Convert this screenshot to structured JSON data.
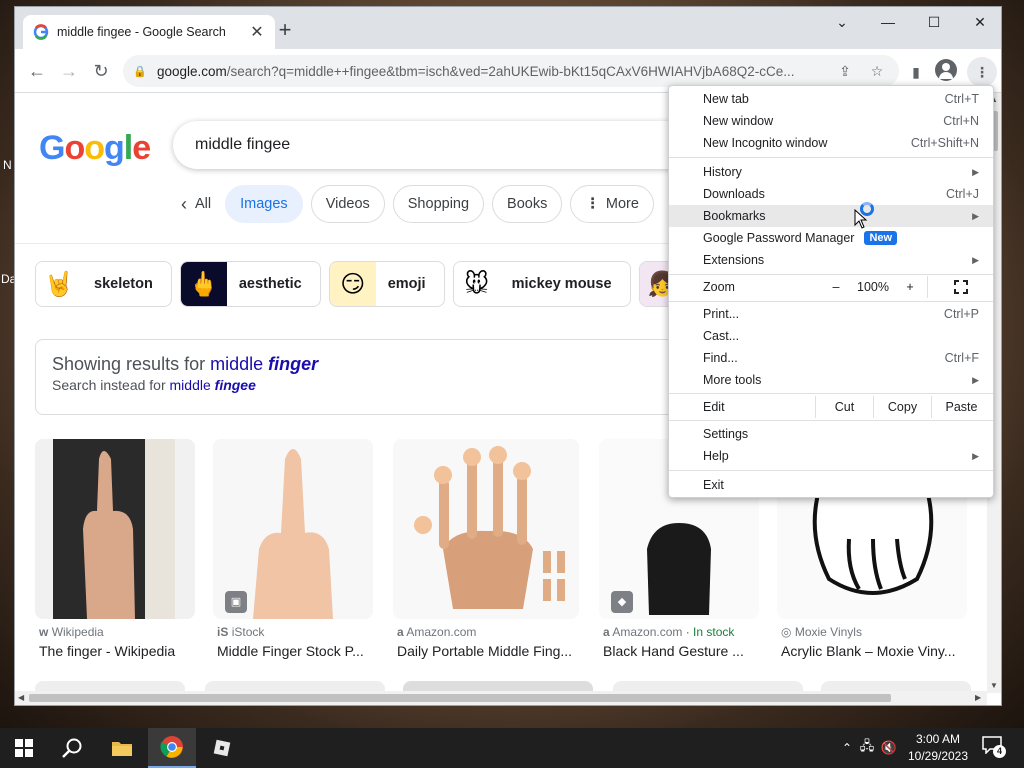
{
  "desktop": {
    "left_label_1": "N",
    "left_label_2": "Da"
  },
  "browser": {
    "tab": {
      "title": "middle fingee - Google Search",
      "close": "✕"
    },
    "new_tab": "+",
    "window_controls": {
      "tabsearch": "⌄",
      "minimize": "—",
      "maximize": "☐",
      "close": "✕"
    },
    "nav": {
      "back": "←",
      "forward": "→",
      "reload": "↻"
    },
    "url": {
      "domain": "google.com",
      "path": "/search?q=middle++fingee&tbm=isch&ved=2ahUKEwib-bKt15qCAxV6HWIAHVjbA68Q2-cCe..."
    }
  },
  "google": {
    "logo": [
      "G",
      "o",
      "o",
      "g",
      "l",
      "e"
    ],
    "query": "middle  fingee",
    "chips": [
      {
        "label": "All",
        "prefix": "‹"
      },
      {
        "label": "Images"
      },
      {
        "label": "Videos"
      },
      {
        "label": "Shopping"
      },
      {
        "label": "Books"
      },
      {
        "label": "More",
        "prefix": "⋮"
      }
    ],
    "refinements": [
      {
        "label": "skeleton",
        "icon": "🤘"
      },
      {
        "label": "aesthetic",
        "icon": "🖕"
      },
      {
        "label": "emoji",
        "icon": "😏"
      },
      {
        "label": "mickey mouse",
        "icon": "🐭"
      },
      {
        "label": "",
        "icon": "👧"
      }
    ],
    "did_you_mean": {
      "showing_prefix": "Showing results for ",
      "showing_word1": "middle",
      "showing_word2": "finger",
      "instead_prefix": "Search instead for ",
      "instead_word1": "middle",
      "instead_word2": "fingee"
    },
    "results": [
      {
        "source": "Wikipedia",
        "source_icon": "w",
        "title": "The finger - Wikipedia"
      },
      {
        "source": "iStock",
        "source_icon": "iS",
        "title": "Middle Finger Stock P..."
      },
      {
        "source": "Amazon.com",
        "source_icon": "a",
        "title": "Daily Portable Middle Fing..."
      },
      {
        "source": "Amazon.com",
        "source_icon": "a",
        "instock": " · In stock",
        "title": "Black Hand Gesture ..."
      },
      {
        "source": "Moxie Vinyls",
        "source_icon": "◎",
        "title": "Acrylic Blank – Moxie Viny..."
      }
    ]
  },
  "menu": {
    "items": {
      "new_tab": {
        "label": "New tab",
        "shortcut": "Ctrl+T"
      },
      "new_window": {
        "label": "New window",
        "shortcut": "Ctrl+N"
      },
      "new_incognito": {
        "label": "New Incognito window",
        "shortcut": "Ctrl+Shift+N"
      },
      "history": {
        "label": "History"
      },
      "downloads": {
        "label": "Downloads",
        "shortcut": "Ctrl+J"
      },
      "bookmarks": {
        "label": "Bookmarks"
      },
      "password_manager": {
        "label": "Google Password Manager",
        "badge": "New"
      },
      "extensions": {
        "label": "Extensions"
      },
      "zoom": {
        "label": "Zoom",
        "minus": "–",
        "value": "100%",
        "plus": "+"
      },
      "print": {
        "label": "Print...",
        "shortcut": "Ctrl+P"
      },
      "cast": {
        "label": "Cast..."
      },
      "find": {
        "label": "Find...",
        "shortcut": "Ctrl+F"
      },
      "more_tools": {
        "label": "More tools"
      },
      "edit": {
        "label": "Edit",
        "cut": "Cut",
        "copy": "Copy",
        "paste": "Paste"
      },
      "settings": {
        "label": "Settings"
      },
      "help": {
        "label": "Help"
      },
      "exit": {
        "label": "Exit"
      }
    },
    "submenu_arrow": "▶"
  },
  "taskbar": {
    "clock_time": "3:00 AM",
    "clock_date": "10/29/2023",
    "notifications_count": "4"
  },
  "colors": {
    "accent": "#1a73e8",
    "link": "#1a0dab",
    "taskbar": "#1f1f1f"
  }
}
